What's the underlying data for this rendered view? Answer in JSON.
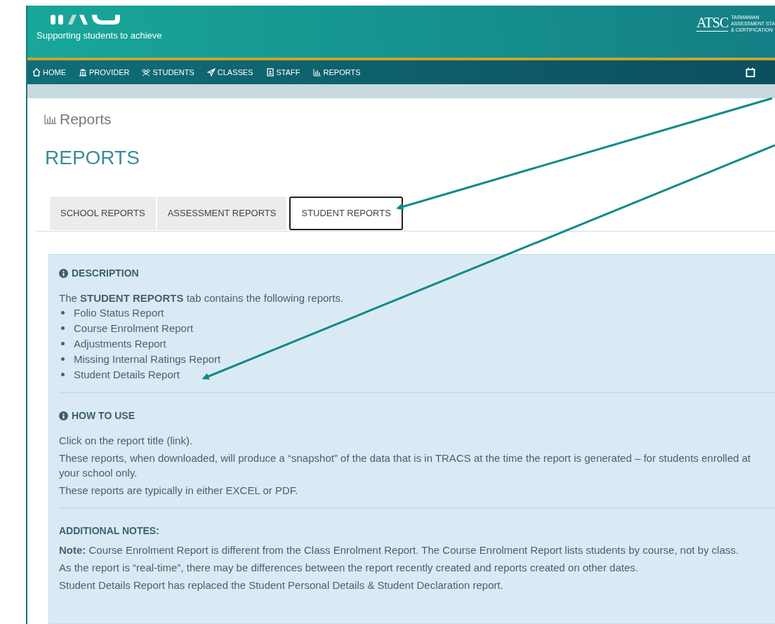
{
  "header": {
    "tagline": "Supporting students to achieve",
    "agency": {
      "monogram": "ATSC",
      "lines": [
        "TASMANIAN",
        "ASSESSMENT STA",
        "& CERTIFICATION"
      ]
    }
  },
  "nav": [
    {
      "label": "HOME",
      "kind": "home"
    },
    {
      "label": "PROVIDER",
      "kind": "provider"
    },
    {
      "label": "STUDENTS",
      "kind": "students"
    },
    {
      "label": "CLASSES",
      "kind": "classes"
    },
    {
      "label": "STAFF",
      "kind": "staff"
    },
    {
      "label": "REPORTS",
      "kind": "reports"
    }
  ],
  "breadcrumb": "Reports",
  "page_title": "REPORTS",
  "tabs": [
    {
      "label": "SCHOOL REPORTS",
      "selected": false
    },
    {
      "label": "ASSESSMENT REPORTS",
      "selected": false
    },
    {
      "label": "STUDENT REPORTS",
      "selected": true
    }
  ],
  "sections": [
    {
      "kind": "info",
      "heading": "DESCRIPTION",
      "paragraphs": [
        "The **STUDENT REPORTS** tab contains the following reports."
      ],
      "items": [
        "Folio Status Report",
        "Course Enrolment Report",
        "Adjustments Report",
        "Missing Internal Ratings Report",
        "Student Details Report"
      ]
    },
    {
      "kind": "info",
      "heading": "HOW TO USE",
      "paragraphs": [
        "Click on the report title (link).",
        "These reports, when downloaded, will produce a “snapshot” of the data that is in TRACS at the time the report is generated – for students enrolled at your school only.",
        "These reports are typically in either EXCEL or PDF."
      ]
    },
    {
      "kind": "plain",
      "heading": "ADDITIONAL NOTES:",
      "paragraphs": [
        "**Note:** Course Enrolment Report is different from the Class Enrolment Report. The Course Enrolment Report lists students by course, not by class.",
        "As the report is “real-time”, there may be differences between the report recently created and reports created on other dates.",
        "Student Details Report has replaced the Student Personal Details & Student Declaration report."
      ]
    }
  ]
}
